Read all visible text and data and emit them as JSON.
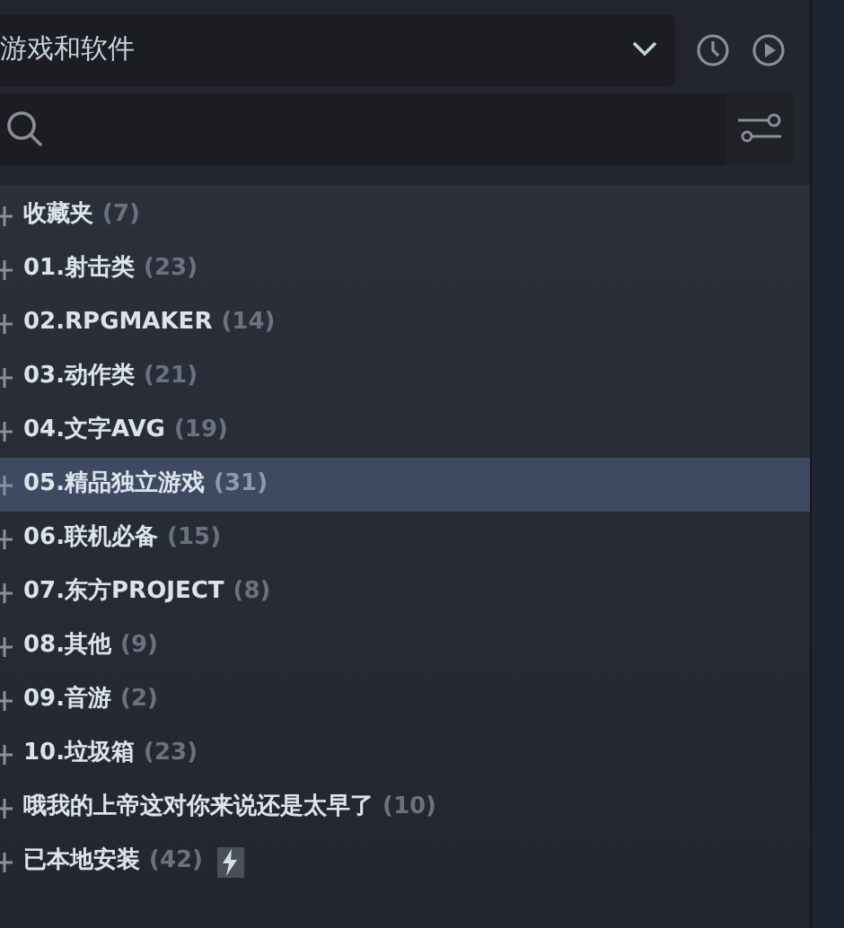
{
  "filter_dropdown": {
    "value": "游戏和软件"
  },
  "collections": [
    {
      "name": "收藏夹",
      "count": "(7)",
      "selected": false,
      "lightning": false
    },
    {
      "name": "01.射击类",
      "count": "(23)",
      "selected": false,
      "lightning": false
    },
    {
      "name": "02.RPGMAKER",
      "count": "(14)",
      "selected": false,
      "lightning": false
    },
    {
      "name": "03.动作类",
      "count": "(21)",
      "selected": false,
      "lightning": false
    },
    {
      "name": "04.文字AVG",
      "count": "(19)",
      "selected": false,
      "lightning": false
    },
    {
      "name": "05.精品独立游戏",
      "count": "(31)",
      "selected": true,
      "lightning": false
    },
    {
      "name": "06.联机必备",
      "count": "(15)",
      "selected": false,
      "lightning": false
    },
    {
      "name": "07.东方PROJECT",
      "count": "(8)",
      "selected": false,
      "lightning": false
    },
    {
      "name": "08.其他",
      "count": "(9)",
      "selected": false,
      "lightning": false
    },
    {
      "name": "09.音游",
      "count": "(2)",
      "selected": false,
      "lightning": false
    },
    {
      "name": "10.垃圾箱",
      "count": "(23)",
      "selected": false,
      "lightning": false
    },
    {
      "name": "哦我的上帝这对你来说还是太早了",
      "count": "(10)",
      "selected": false,
      "lightning": false
    },
    {
      "name": "已本地安装",
      "count": "(42)",
      "selected": false,
      "lightning": true
    }
  ]
}
